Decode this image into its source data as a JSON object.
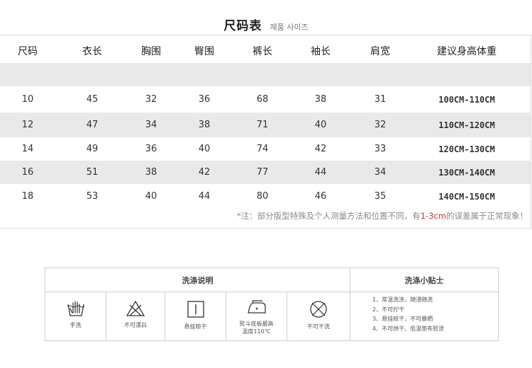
{
  "title": {
    "main": "尺码表",
    "sub": "제품 사이즈"
  },
  "size_chart": {
    "headers": [
      "尺码",
      "衣长",
      "胸围",
      "臀围",
      "裤长",
      "袖长",
      "肩宽",
      "建议身高体重"
    ],
    "rows": [
      [
        "10",
        "45",
        "32",
        "36",
        "68",
        "38",
        "31",
        "100CM-110CM"
      ],
      [
        "12",
        "47",
        "34",
        "38",
        "71",
        "40",
        "32",
        "110CM-120CM"
      ],
      [
        "14",
        "49",
        "36",
        "40",
        "74",
        "42",
        "33",
        "120CM-130CM"
      ],
      [
        "16",
        "51",
        "38",
        "42",
        "77",
        "44",
        "34",
        "130CM-140CM"
      ],
      [
        "18",
        "53",
        "40",
        "44",
        "80",
        "46",
        "35",
        "140CM-150CM"
      ]
    ]
  },
  "note": {
    "before": "*注：部分版型特殊及个人测量方法和位置不同，有",
    "highlight": "1-3cm",
    "after": "的误差属于正常现象！"
  },
  "care": {
    "section_title": "洗涤说明",
    "tips_title": "洗涤小贴士",
    "icons": [
      {
        "icon": "hand-wash-icon",
        "label": "手洗"
      },
      {
        "icon": "no-bleach-icon",
        "label": "不可漂白"
      },
      {
        "icon": "hang-dry-icon",
        "label": "悬挂晾干"
      },
      {
        "icon": "iron-icon",
        "label": "熨斗底板最高",
        "label2": "温度110℃"
      },
      {
        "icon": "no-dry-clean-icon",
        "label": "不可干洗"
      }
    ],
    "tips": [
      "1、常温洗涤，随浸随洗",
      "2、不可拧干",
      "3、悬挂晾干，不可暴晒",
      "4、不可烘干、低温垫布熨烫"
    ]
  },
  "colors": {
    "shade": "#e9e9e9",
    "border": "#d8d8d8",
    "highlight": "#c0392b"
  }
}
